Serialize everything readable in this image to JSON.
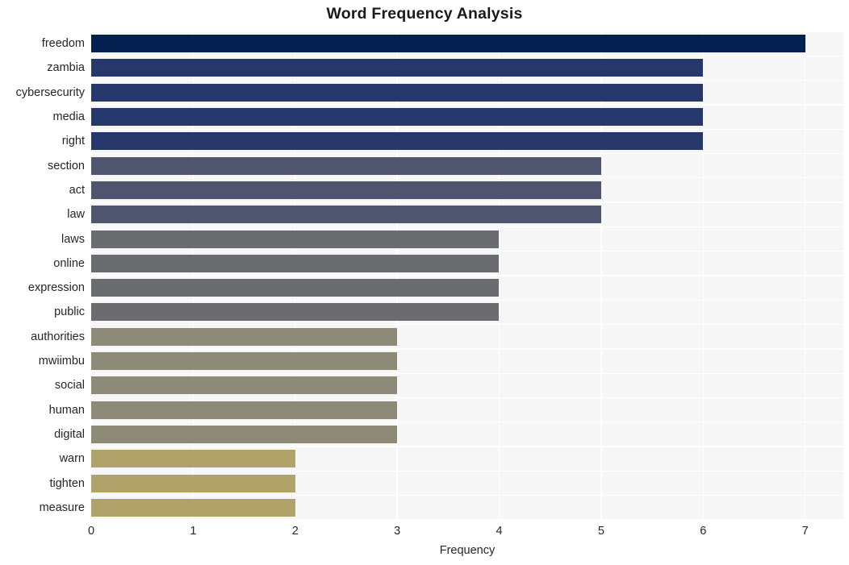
{
  "chart_data": {
    "type": "bar",
    "orientation": "horizontal",
    "title": "Word Frequency Analysis",
    "xlabel": "Frequency",
    "ylabel": "",
    "xlim": [
      0,
      7.375
    ],
    "xticks": [
      0,
      1,
      2,
      3,
      4,
      5,
      6,
      7
    ],
    "xtick_labels": [
      "0",
      "1",
      "2",
      "3",
      "4",
      "5",
      "6",
      "7"
    ],
    "grid": true,
    "grid_axis": "both",
    "grid_color": "#ffffff",
    "plot_background": "#f6f6f7",
    "figure_background": "#ffffff",
    "legend": null,
    "categories": [
      "freedom",
      "zambia",
      "cybersecurity",
      "media",
      "right",
      "section",
      "act",
      "law",
      "laws",
      "online",
      "expression",
      "public",
      "authorities",
      "mwiimbu",
      "social",
      "human",
      "digital",
      "warn",
      "tighten",
      "measure"
    ],
    "values": [
      7,
      6,
      6,
      6,
      6,
      5,
      5,
      5,
      4,
      4,
      4,
      4,
      3,
      3,
      3,
      3,
      3,
      2,
      2,
      2
    ],
    "bar_colors": [
      "#042050",
      "#25376b",
      "#25376b",
      "#25376b",
      "#25376b",
      "#4f556e",
      "#4f556e",
      "#4f556e",
      "#6b6c70",
      "#6b6c70",
      "#6b6c70",
      "#6b6c70",
      "#8d8a78",
      "#8d8a78",
      "#8d8a78",
      "#8d8a78",
      "#8d8a78",
      "#b0a369",
      "#b0a369",
      "#b0a369"
    ],
    "bars": [
      {
        "label": "freedom",
        "value": 7,
        "color": "#042050"
      },
      {
        "label": "zambia",
        "value": 6,
        "color": "#25376b"
      },
      {
        "label": "cybersecurity",
        "value": 6,
        "color": "#25376b"
      },
      {
        "label": "media",
        "value": 6,
        "color": "#25376b"
      },
      {
        "label": "right",
        "value": 6,
        "color": "#25376b"
      },
      {
        "label": "section",
        "value": 5,
        "color": "#4f556e"
      },
      {
        "label": "act",
        "value": 5,
        "color": "#4f556e"
      },
      {
        "label": "law",
        "value": 5,
        "color": "#4f556e"
      },
      {
        "label": "laws",
        "value": 4,
        "color": "#6b6c70"
      },
      {
        "label": "online",
        "value": 4,
        "color": "#6b6c70"
      },
      {
        "label": "expression",
        "value": 4,
        "color": "#6b6c70"
      },
      {
        "label": "public",
        "value": 4,
        "color": "#6b6c70"
      },
      {
        "label": "authorities",
        "value": 3,
        "color": "#8d8a78"
      },
      {
        "label": "mwiimbu",
        "value": 3,
        "color": "#8d8a78"
      },
      {
        "label": "social",
        "value": 3,
        "color": "#8d8a78"
      },
      {
        "label": "human",
        "value": 3,
        "color": "#8d8a78"
      },
      {
        "label": "digital",
        "value": 3,
        "color": "#8d8a78"
      },
      {
        "label": "warn",
        "value": 2,
        "color": "#b0a369"
      },
      {
        "label": "tighten",
        "value": 2,
        "color": "#b0a369"
      },
      {
        "label": "measure",
        "value": 2,
        "color": "#b0a369"
      }
    ]
  }
}
